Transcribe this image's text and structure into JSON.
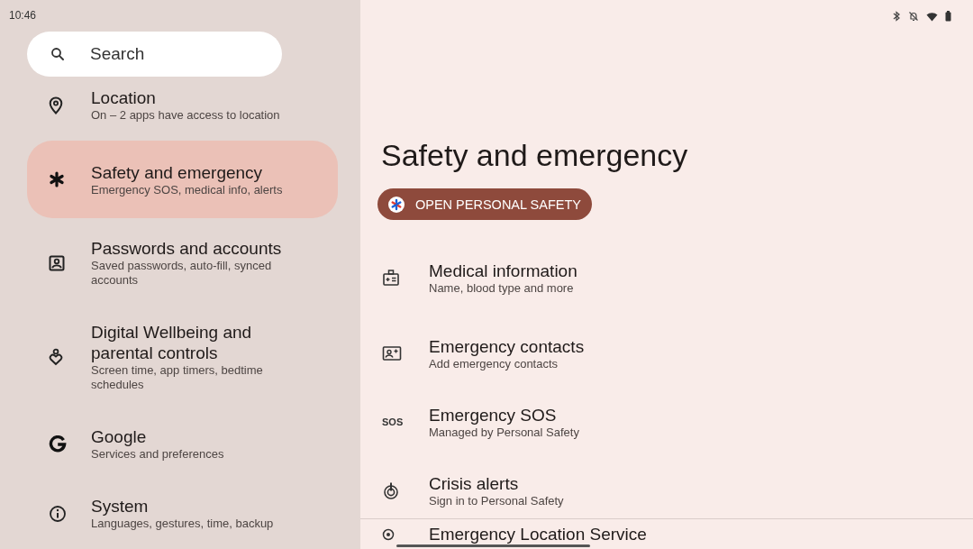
{
  "status_bar": {
    "time": "10:46"
  },
  "search": {
    "placeholder": "Search"
  },
  "sidebar": {
    "items": [
      {
        "title": "Location",
        "subtitle": "On – 2 apps have access to location",
        "selected": false
      },
      {
        "title": "Safety and emergency",
        "subtitle": "Emergency SOS, medical info, alerts",
        "selected": true
      },
      {
        "title": "Passwords and accounts",
        "subtitle": "Saved passwords, auto-fill, synced accounts",
        "selected": false
      },
      {
        "title": "Digital Wellbeing and parental controls",
        "subtitle": "Screen time, app timers, bedtime schedules",
        "selected": false
      },
      {
        "title": "Google",
        "subtitle": "Services and preferences",
        "selected": false
      },
      {
        "title": "System",
        "subtitle": "Languages, gestures, time, backup",
        "selected": false
      }
    ]
  },
  "page": {
    "title": "Safety and emergency",
    "button": "OPEN PERSONAL SAFETY",
    "items": [
      {
        "title": "Medical information",
        "subtitle": "Name, blood type and more"
      },
      {
        "title": "Emergency contacts",
        "subtitle": "Add emergency contacts"
      },
      {
        "title": "Emergency SOS",
        "subtitle": "Managed by Personal Safety",
        "icon_text": "SOS"
      },
      {
        "title": "Crisis alerts",
        "subtitle": "Sign in to Personal Safety"
      }
    ],
    "footer_item": {
      "title": "Emergency Location Service"
    }
  }
}
